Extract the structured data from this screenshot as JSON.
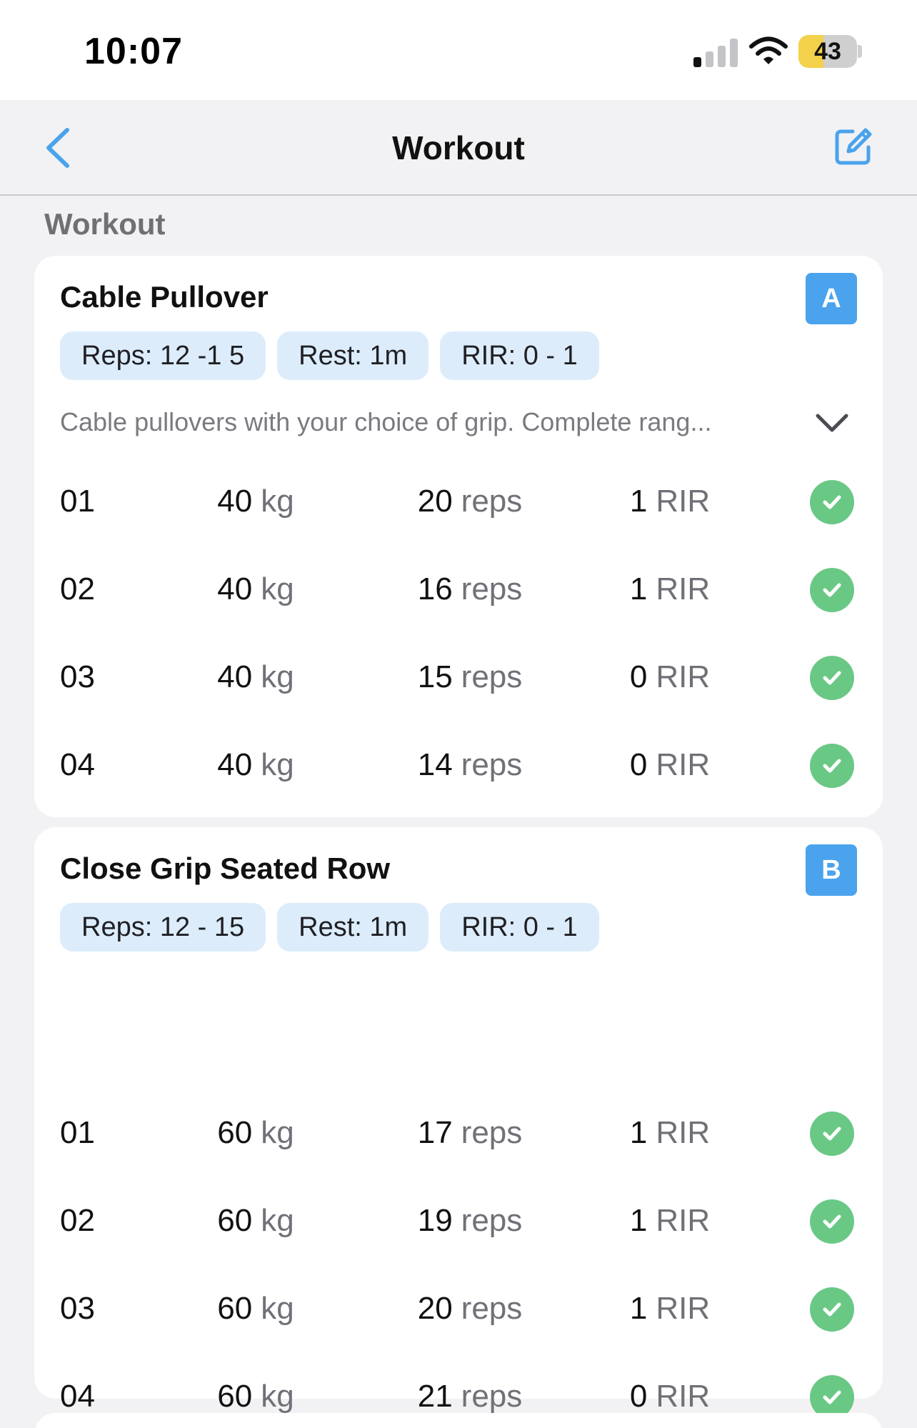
{
  "status": {
    "time": "10:07",
    "battery": "43"
  },
  "nav": {
    "title": "Workout"
  },
  "section": {
    "title": "Workout"
  },
  "exercises": [
    {
      "name": "Cable Pullover",
      "badge": "A",
      "chips": {
        "reps": "Reps: 12 -1 5",
        "rest": "Rest: 1m",
        "rir": "RIR: 0 - 1"
      },
      "description": "Cable pullovers with your choice of grip. Complete rang...",
      "sets": [
        {
          "num": "01",
          "weight": "40",
          "weight_unit": "kg",
          "reps": "20",
          "reps_unit": "reps",
          "rir": "1",
          "rir_unit": "RIR"
        },
        {
          "num": "02",
          "weight": "40",
          "weight_unit": "kg",
          "reps": "16",
          "reps_unit": "reps",
          "rir": "1",
          "rir_unit": "RIR"
        },
        {
          "num": "03",
          "weight": "40",
          "weight_unit": "kg",
          "reps": "15",
          "reps_unit": "reps",
          "rir": "0",
          "rir_unit": "RIR"
        },
        {
          "num": "04",
          "weight": "40",
          "weight_unit": "kg",
          "reps": "14",
          "reps_unit": "reps",
          "rir": "0",
          "rir_unit": "RIR"
        }
      ]
    },
    {
      "name": "Close Grip Seated Row",
      "badge": "B",
      "chips": {
        "reps": "Reps: 12 - 15",
        "rest": "Rest: 1m",
        "rir": "RIR: 0 - 1"
      },
      "sets": [
        {
          "num": "01",
          "weight": "60",
          "weight_unit": "kg",
          "reps": "17",
          "reps_unit": "reps",
          "rir": "1",
          "rir_unit": "RIR"
        },
        {
          "num": "02",
          "weight": "60",
          "weight_unit": "kg",
          "reps": "19",
          "reps_unit": "reps",
          "rir": "1",
          "rir_unit": "RIR"
        },
        {
          "num": "03",
          "weight": "60",
          "weight_unit": "kg",
          "reps": "20",
          "reps_unit": "reps",
          "rir": "1",
          "rir_unit": "RIR"
        },
        {
          "num": "04",
          "weight": "60",
          "weight_unit": "kg",
          "reps": "21",
          "reps_unit": "reps",
          "rir": "0",
          "rir_unit": "RIR"
        }
      ]
    }
  ],
  "colors": {
    "accent": "#4aa3ec",
    "check": "#6ac885",
    "chip": "#dcecfb"
  },
  "icons": {
    "back": "chevron-left-icon",
    "edit": "edit-icon",
    "expand": "chevron-down-icon",
    "done": "check-circle-icon"
  }
}
